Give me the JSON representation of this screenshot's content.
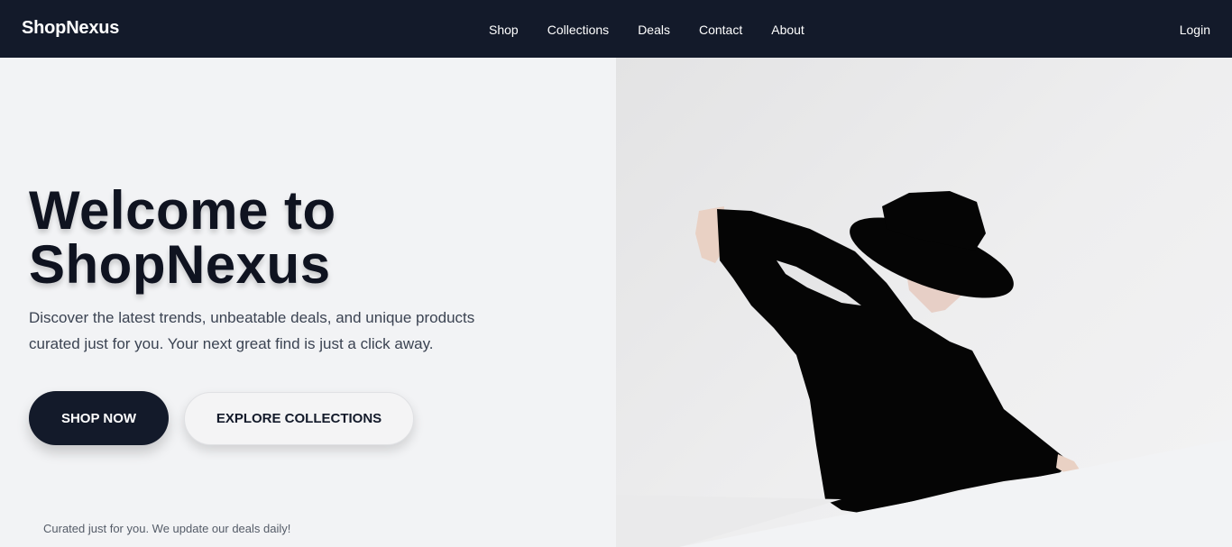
{
  "brand": "ShopNexus",
  "nav": {
    "links": [
      "Shop",
      "Collections",
      "Deals",
      "Contact",
      "About"
    ],
    "login": "Login"
  },
  "hero": {
    "title_line1": "Welcome to",
    "title_line2": "ShopNexus",
    "description_line1": "Discover the latest trends, unbeatable deals, and unique products",
    "description_line2": "curated just for you. Your next great find is just a click away.",
    "primary_button": "SHOP NOW",
    "secondary_button": "EXPLORE COLLECTIONS",
    "tagline": "Curated just for you. We update our deals daily!"
  },
  "colors": {
    "navbar_bg": "#131a2a",
    "page_bg": "#f2f3f5",
    "primary_button_bg": "#131a2a",
    "lipstick": "#c8102e"
  }
}
